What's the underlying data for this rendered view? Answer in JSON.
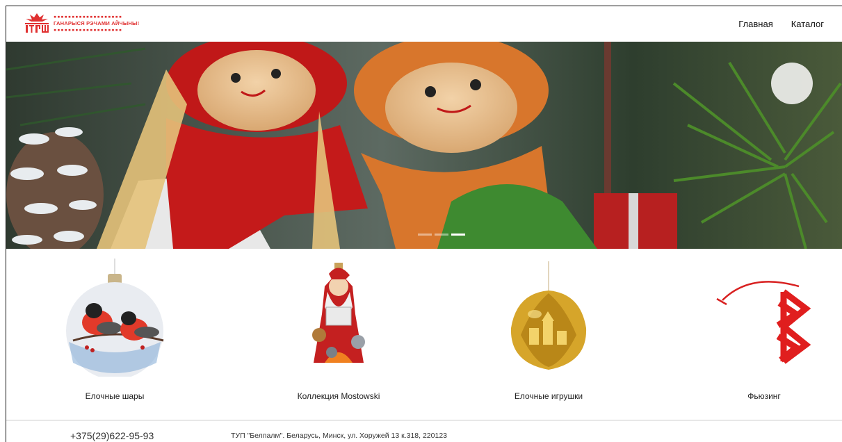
{
  "header": {
    "logo_text": "ГАНАРЫСЯ РЭЧАМИ АЙЧЫНЫ!",
    "logo_dots": "▪▪▪▪▪▪▪▪▪▪▪▪▪▪▪▪▪▪▪",
    "nav": [
      {
        "label": "Главная"
      },
      {
        "label": "Каталог"
      }
    ]
  },
  "hero": {
    "slides_count": 3,
    "active_slide": 3
  },
  "categories": [
    {
      "label": "Елочные шары",
      "icon": "bauble-bullfinches-image"
    },
    {
      "label": "Коллекция Mostowski",
      "icon": "santa-ornament-image"
    },
    {
      "label": "Елочные игрушки",
      "icon": "golden-walnut-ornament-image"
    },
    {
      "label": "Фьюзинг",
      "icon": "red-fusing-ornament-image"
    }
  ],
  "footer": {
    "phone": "+375(29)622-95-93",
    "address": "ТУП \"Белпалм\". Беларусь, Минск, ул. Хоружей 13 к.318, 220123"
  },
  "colors": {
    "brand_red": "#e03030",
    "text": "#111111"
  }
}
